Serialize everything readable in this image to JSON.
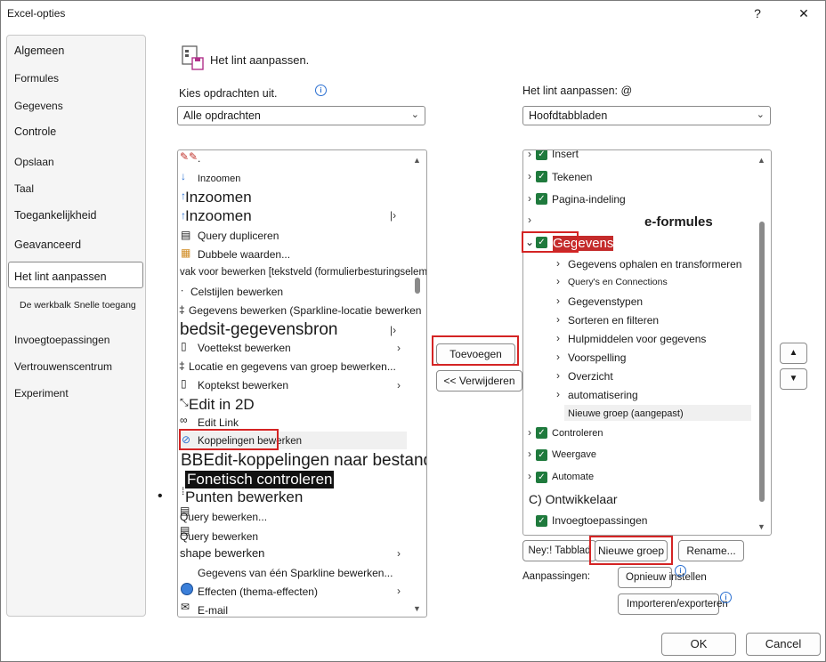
{
  "window": {
    "title": "Excel-opties",
    "help": "?",
    "close": "✕"
  },
  "nav": {
    "items": [
      {
        "label": "Algemeen"
      },
      {
        "label": "Formules"
      },
      {
        "label": "Gegevens"
      },
      {
        "label": "Controle"
      },
      {
        "label": "Opslaan"
      },
      {
        "label": "Taal"
      },
      {
        "label": "Toegankelijkheid"
      },
      {
        "label": "Geavanceerd"
      },
      {
        "label": "Het lint aanpassen"
      },
      {
        "label": "De werkbalk Snelle toegang"
      },
      {
        "label": "Invoegtoepassingen"
      },
      {
        "label": "Vertrouwenscentrum"
      },
      {
        "label": "Experiment"
      }
    ]
  },
  "header": {
    "title": "Het lint aanpassen."
  },
  "left": {
    "label": "Kies opdrachten uit.",
    "combo": "Alle opdrachten",
    "items": [
      "Inzoomen",
      "Inzoomen",
      "Inzoomen",
      "Query dupliceren",
      "Dubbele waarden...",
      "vak voor bewerken [tekstveld (formulierbesturingselement)",
      "Celstijlen bewerken",
      "Gegevens bewerken (Sparkline-locatie bewerken",
      "bedsit-gegevensbron",
      "Voettekst bewerken",
      "Locatie en gegevens van groep bewerken...",
      "Koptekst bewerken",
      "Edit in 2D",
      "Edit Link",
      "Koppelingen bewerken",
      "BBEdit-koppelingen naar bestanden",
      "Fonetisch controleren",
      "Punten bewerken",
      "Query bewerken...",
      "Query bewerken",
      "shape bewerken",
      "Gegevens van één Sparkline bewerken...",
      "Effecten (thema-effecten)",
      "E-mail"
    ]
  },
  "middle": {
    "add": "Toevoegen",
    "remove": "<< Verwijderen"
  },
  "right": {
    "label": "Het lint aanpassen: @",
    "combo": "Hoofdtabbladen",
    "items": [
      "Insert",
      "Tekenen",
      "Pagina-indeling",
      "e-formules",
      "Gegevens",
      "Gegevens ophalen en transformeren",
      "Query's en Connections",
      "Gegevenstypen",
      "Sorteren en filteren",
      "Hulpmiddelen voor gegevens",
      "Voorspelling",
      "Overzicht",
      "automatisering",
      "Nieuwe groep (aangepast)",
      "Controleren",
      "Weergave",
      "Automate",
      "C) Ontwikkelaar",
      "Invoegtoepassingen"
    ]
  },
  "bottom": {
    "new_tab": "Ney:! Tabblad",
    "new_group": "Nieuwe groep",
    "rename": "Rename...",
    "customizations": "Aanpassingen:",
    "reset": "Opnieuw instellen",
    "import_export": "Importeren/exporteren",
    "ok": "OK",
    "cancel": "Cancel"
  },
  "colors": {
    "accent": "#1f7a3d",
    "highlight": "#d42424"
  }
}
